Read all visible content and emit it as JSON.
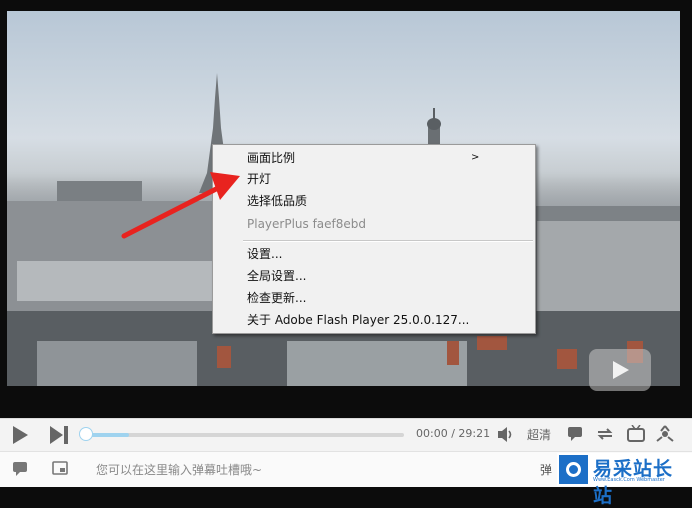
{
  "context_menu": {
    "items": [
      {
        "label": "画面比例",
        "submenu_indicator": ">",
        "disabled": false
      },
      {
        "label": "开灯",
        "disabled": false
      },
      {
        "label": "选择低品质",
        "disabled": false
      },
      {
        "label": "PlayerPlus faef8ebd",
        "disabled": true
      },
      {
        "label": "设置...",
        "disabled": false
      },
      {
        "label": "全局设置...",
        "disabled": false
      },
      {
        "label": "检查更新...",
        "disabled": false
      },
      {
        "label": "关于 Adobe Flash Player 25.0.0.127...",
        "disabled": false
      }
    ]
  },
  "controls": {
    "time_display": "00:00 / 29:21",
    "quality_label": "超清",
    "progress_fraction": 0.14
  },
  "danmaku": {
    "input_placeholder": "您可以在这里输入弹幕吐槽哦~",
    "send_label": "弹"
  },
  "watermark": {
    "title": "易采站长站",
    "subtitle": "Www.Easck.Com  Webmaster"
  },
  "colors": {
    "arrow": "#e8231f",
    "progress": "#9fd3ef",
    "watermark": "#1c6fc7"
  }
}
